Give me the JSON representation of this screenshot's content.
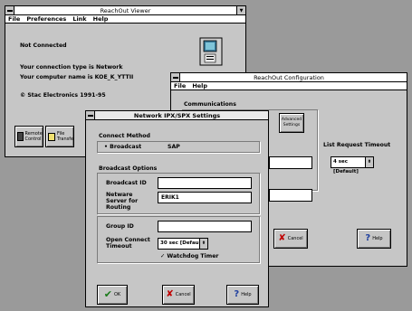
{
  "viewer": {
    "title": "ReachOut Viewer",
    "menu": [
      "File",
      "Preferences",
      "Link",
      "Help"
    ],
    "status": "Not Connected",
    "conn_type": "Your connection type is Network",
    "comp_name": "Your computer name is KOE_K_YTTII",
    "copyright": "© Stac Electronics 1991-95",
    "btn_remote": "Remote Control",
    "btn_file": "File Transfer"
  },
  "config": {
    "title": "ReachOut Configuration",
    "menu": [
      "File",
      "Help"
    ],
    "communications": "Communications",
    "advanced": "Advanced Settings",
    "list_timeout_label": "List Request Timeout",
    "list_timeout_value": "4 sec [Default]",
    "cancel": "Cancel",
    "help": "Help"
  },
  "netware": {
    "title": "Network IPX/SPX Settings",
    "connect_method": "Connect Method",
    "broadcast": "Broadcast",
    "sap": "SAP",
    "broadcast_options": "Broadcast Options",
    "broadcast_id_label": "Broadcast ID",
    "broadcast_id_value": "",
    "netware_server_label": "Netware Server for Routing",
    "netware_server_value": "ERIK1",
    "group_id_label": "Group ID",
    "group_id_value": "",
    "open_connect_label": "Open Connect Timeout",
    "open_connect_value": "30 sec [Default]",
    "watchdog": "Watchdog Timer",
    "ok": "OK",
    "cancel": "Cancel",
    "help": "Help"
  }
}
